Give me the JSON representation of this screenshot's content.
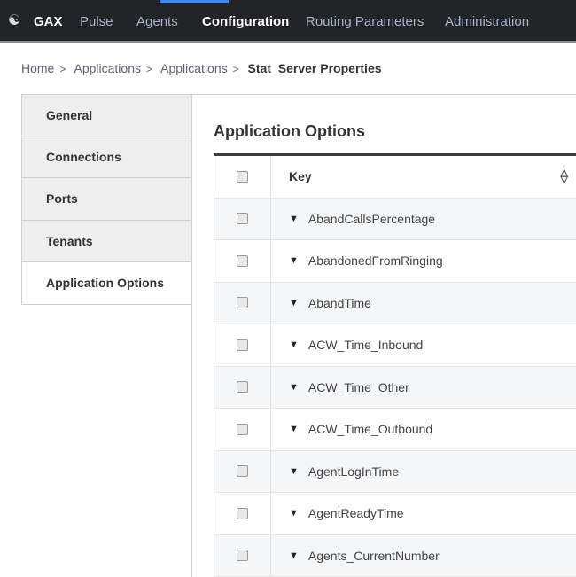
{
  "nav": {
    "brand": "GAX",
    "items": [
      "Pulse",
      "Agents",
      "Configuration",
      "Routing Parameters",
      "Administration"
    ],
    "active": "Configuration"
  },
  "breadcrumb": [
    "Home",
    "Applications",
    "Applications",
    "Stat_Server Properties"
  ],
  "tabs": [
    "General",
    "Connections",
    "Ports",
    "Tenants",
    "Application Options"
  ],
  "selected_tab": "Application Options",
  "content": {
    "title": "Application Options",
    "column_key": "Key",
    "rows": [
      "AbandCallsPercentage",
      "AbandonedFromRinging",
      "AbandTime",
      "ACW_Time_Inbound",
      "ACW_Time_Other",
      "ACW_Time_Outbound",
      "AgentLogInTime",
      "AgentReadyTime",
      "Agents_CurrentNumber"
    ]
  },
  "colors": {
    "nav_bg": "#222428",
    "accent": "#4a86e8"
  }
}
